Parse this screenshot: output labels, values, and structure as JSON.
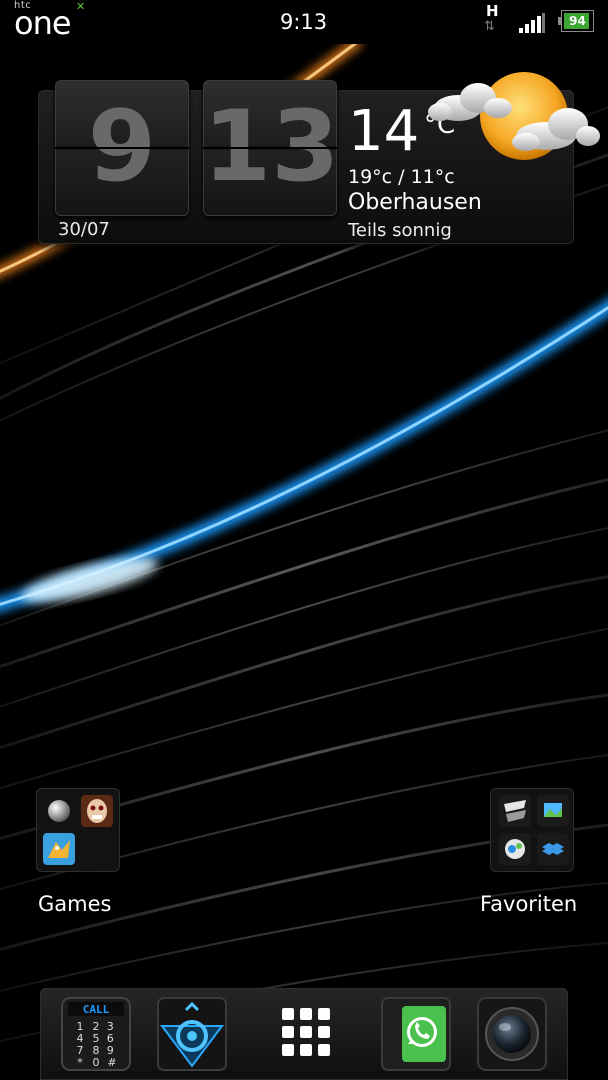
{
  "status_bar": {
    "brand_small": "htc",
    "brand": "one",
    "time": "9:13",
    "network_type": "H",
    "battery_level": "94",
    "battery_fraction": 0.94,
    "icons": [
      "htc-one-logo-icon",
      "network-activity-icon",
      "signal-strength-icon",
      "battery-icon"
    ]
  },
  "widget": {
    "hour": "9",
    "minute": "13",
    "date": "30/07",
    "temperature": "14",
    "temperature_unit": "°C",
    "high_low": "19°c / 11°c",
    "city": "Oberhausen",
    "condition": "Teils sonnig",
    "weather_icon": "partly-sunny-icon"
  },
  "folders": [
    {
      "label": "Games",
      "apps": [
        "ball-app-icon",
        "zombie-game-icon",
        "dragon-game-icon"
      ]
    },
    {
      "label": "Favoriten",
      "apps": [
        "tv-app-icon",
        "photo-app-icon",
        "mail-app-icon",
        "dropbox-icon"
      ]
    }
  ],
  "dock": {
    "apps": [
      {
        "name": "phone-dialer",
        "caption": "CALL",
        "keys": "1 2 3 4 5 6 7 8 9 * 0 #"
      },
      {
        "name": "browser"
      },
      {
        "name": "app-drawer"
      },
      {
        "name": "whatsapp"
      },
      {
        "name": "camera"
      }
    ]
  },
  "colors": {
    "accent_blue": "#1e9bff",
    "accent_orange": "#ff8a1a",
    "battery_green": "#3da534",
    "whatsapp_green": "#4ac14d"
  }
}
